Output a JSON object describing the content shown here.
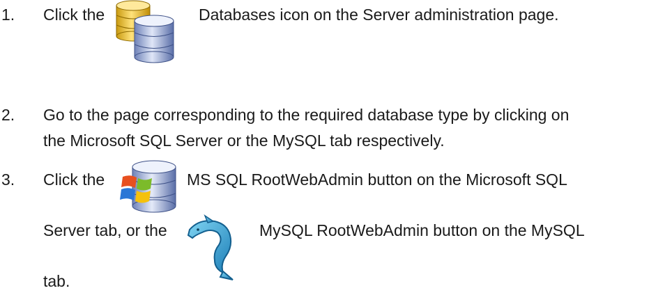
{
  "steps": [
    {
      "number": "1.",
      "prefix": "Click the",
      "icon": "databases-icon",
      "suffix": "Databases icon on the Server administration page."
    },
    {
      "number": "2.",
      "line1": "Go to the page corresponding to the required database type by clicking on",
      "line2": "the Microsoft SQL Server or the MySQL tab respectively."
    },
    {
      "number": "3.",
      "prefix": "Click the",
      "icon_mssql": "mssql-root-web-admin-icon",
      "mid1": "MS SQL RootWebAdmin button on the Microsoft SQL",
      "mid2": "Server tab, or the",
      "icon_mysql": "mysql-dolphin-icon",
      "mid3": "MySQL RootWebAdmin button on the MySQL",
      "end": "tab."
    }
  ]
}
